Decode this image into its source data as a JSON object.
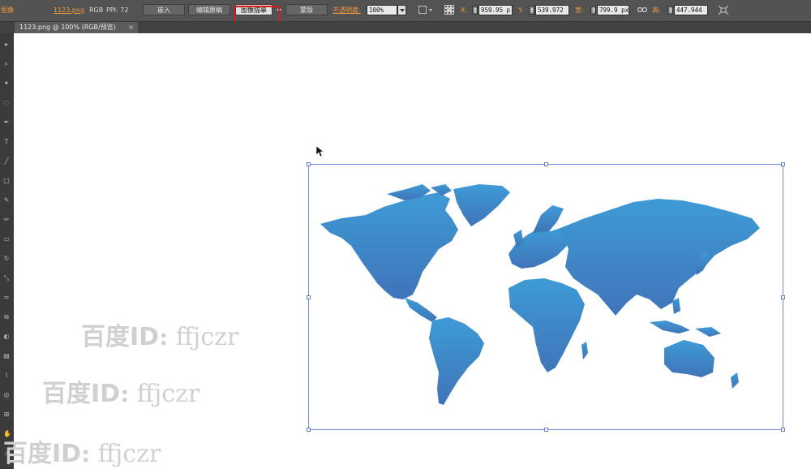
{
  "control_bar": {
    "label_left": "图像",
    "file_name": "1123.png",
    "color_mode": "RGB",
    "ppi_text": "PPI: 72",
    "embed_button": "嵌入",
    "edit_original_button": "编辑原稿",
    "image_trace_button": "图像描摹",
    "mask_button": "蒙版",
    "opacity_label": "不透明度:",
    "opacity_value": "100%",
    "x_label": "X:",
    "x_value": "959.95 p",
    "y_label": "Y:",
    "y_value": "539.972",
    "width_label": "宽:",
    "width_value": "799.9 px",
    "height_label": "高:",
    "height_value": "447.944"
  },
  "document_tab": {
    "title": "1123.png @ 100% (RGB/预览)",
    "close": "×"
  },
  "watermarks": [
    {
      "cn": "百度",
      "id": "ID",
      "colon": ":",
      "user": " ffjczr"
    },
    {
      "cn": "百度",
      "id": "ID",
      "colon": ":",
      "user": " ffjczr"
    },
    {
      "cn": "百度",
      "id": "ID",
      "colon": ":",
      "user": " ffjczr"
    }
  ],
  "colors": {
    "map_top": "#3e9bd6",
    "map_bottom": "#3f74b8",
    "selection": "#5f80cf",
    "highlight": "#d21b1b",
    "accent_label": "#f09a3e"
  }
}
